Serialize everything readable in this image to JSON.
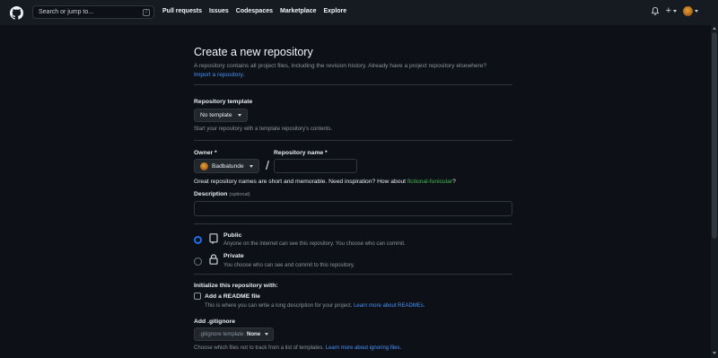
{
  "header": {
    "search_placeholder": "Search or jump to...",
    "slash_key": "/",
    "nav": [
      "Pull requests",
      "Issues",
      "Codespaces",
      "Marketplace",
      "Explore"
    ],
    "plus_label": "+"
  },
  "page": {
    "title": "Create a new repository",
    "subtitle": "A repository contains all project files, including the revision history. Already have a project repository elsewhere?",
    "import_link": "Import a repository."
  },
  "template": {
    "label": "Repository template",
    "button": "No template",
    "hint": "Start your repository with a template repository's contents."
  },
  "owner": {
    "label": "Owner *",
    "value": "Badbatunde",
    "separator": "/"
  },
  "repo_name": {
    "label": "Repository name *",
    "value": ""
  },
  "inspiration": {
    "text": "Great repository names are short and memorable. Need inspiration? How about",
    "suggestion": "fictional-funicular",
    "end": "?"
  },
  "description": {
    "label": "Description",
    "optional": "(optional)",
    "value": ""
  },
  "visibility": {
    "public_title": "Public",
    "public_desc": "Anyone on the internet can see this repository. You choose who can commit.",
    "private_title": "Private",
    "private_desc": "You choose who can see and commit to this repository.",
    "selected": "public"
  },
  "initialize": {
    "heading": "Initialize this repository with:",
    "readme_label": "Add a README file",
    "readme_hint": "This is where you can write a long description for your project.",
    "readme_link": "Learn more about READMEs.",
    "readme_checked": false
  },
  "gitignore": {
    "label": "Add .gitignore",
    "button_prefix": ".gitignore template:",
    "button_value": "None",
    "hint": "Choose which files not to track from a list of templates.",
    "hint_link": "Learn more about ignoring files."
  },
  "colors": {
    "background": "#0d1117",
    "header": "#161b22",
    "accent_link": "#4493f8",
    "radio_selected": "#1f6feb",
    "suggestion_green": "#3fb950"
  }
}
